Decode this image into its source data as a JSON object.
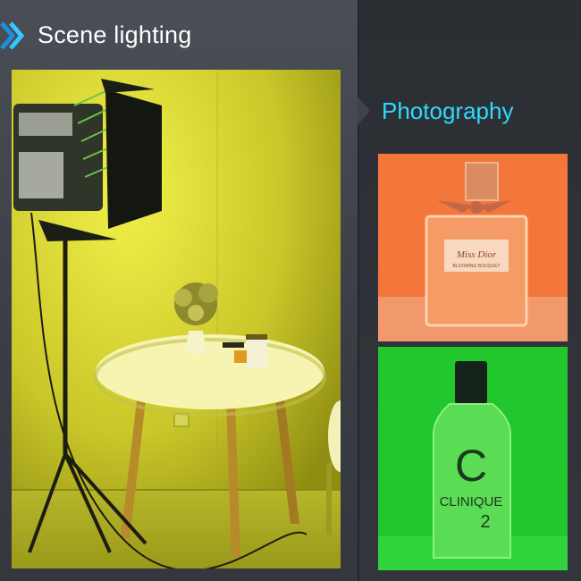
{
  "header": {
    "title": "Scene lighting"
  },
  "side": {
    "title": "Photography"
  },
  "photos": {
    "perfume": {
      "label_line1": "Miss Dior",
      "label_line2": "BLOOMING BOUQUET"
    },
    "lotion": {
      "brand": "CLINIQUE",
      "number": "2"
    }
  },
  "icons": [
    "chevron-icon"
  ],
  "colors": {
    "accent": "#2fd9ff",
    "scene_light": "#d7d633",
    "perfume_light": "#f47a3a",
    "lotion_light": "#23c52e"
  }
}
